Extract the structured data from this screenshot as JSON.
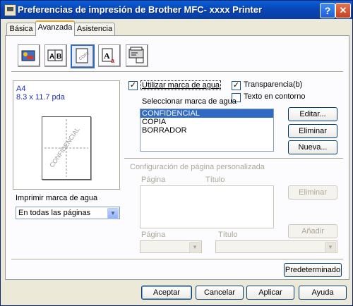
{
  "titlebar": {
    "title": "Preferencias de impresión de Brother MFC- xxxx   Printer",
    "help_label": "?",
    "close_label": "✕"
  },
  "tabs": [
    {
      "label": "Básica"
    },
    {
      "label": "Avanzada"
    },
    {
      "label": "Asistencia"
    }
  ],
  "toolbar_icons": [
    "color-icon",
    "duplex-icon",
    "watermark-icon",
    "fonts-icon",
    "device-options-icon"
  ],
  "preview": {
    "paper_size": "A4",
    "paper_dims": "8.3 x 11.7 pda",
    "watermark_text": "CONFIDENCIAL"
  },
  "print_watermark": {
    "label": "Imprimir marca de agua",
    "selected": "En todas las páginas"
  },
  "use_watermark": {
    "label": "Utilizar marca de agua",
    "checked": true
  },
  "transparency": {
    "label": "Transparencia(b)",
    "checked": true
  },
  "outline_text": {
    "label": "Texto en contorno",
    "checked": false
  },
  "select_watermark": {
    "label": "Seleccionar marca de agua",
    "items": [
      "CONFIDENCIAL",
      "COPIA",
      "BORRADOR"
    ]
  },
  "buttons": {
    "edit": "Editar...",
    "delete": "Eliminar",
    "new": "Nueva...",
    "delete2": "Eliminar",
    "add": "Añadir",
    "default": "Predeterminado",
    "ok": "Aceptar",
    "cancel": "Cancelar",
    "apply": "Aplicar",
    "help": "Ayuda"
  },
  "custom_page": {
    "label": "Configuración de página personalizada",
    "col_page": "Página",
    "col_title": "Título",
    "page_label": "Página",
    "title_label": "Título"
  }
}
